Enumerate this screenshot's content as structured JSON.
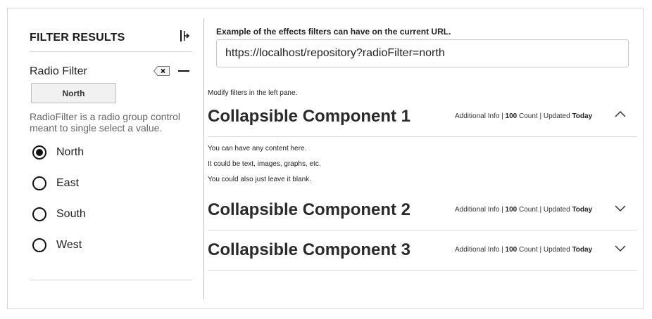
{
  "filter_pane": {
    "title": "FILTER RESULTS",
    "radio_filter": {
      "heading": "Radio Filter",
      "selected_chip": "North",
      "description": "RadioFilter is a radio group control meant to single select a value.",
      "options": [
        {
          "label": "North",
          "selected": true
        },
        {
          "label": "East",
          "selected": false
        },
        {
          "label": "South",
          "selected": false
        },
        {
          "label": "West",
          "selected": false
        }
      ]
    }
  },
  "main": {
    "url_caption": "Example of the effects filters can have on the current URL.",
    "url_value": "https://localhost/repository?radioFilter=north",
    "modify_note": "Modify filters in the left pane.",
    "components": [
      {
        "title": "Collapsible Component 1",
        "info": {
          "prefix": "Additional Info | ",
          "count": "100",
          "mid": " Count | Updated ",
          "updated": "Today"
        },
        "expanded": true,
        "content": [
          "You can have any content here.",
          "It could be text, images, graphs, etc.",
          "You could also just leave it blank."
        ]
      },
      {
        "title": "Collapsible Component 2",
        "info": {
          "prefix": "Additional Info | ",
          "count": "100",
          "mid": " Count | Updated ",
          "updated": "Today"
        },
        "expanded": false,
        "content": []
      },
      {
        "title": "Collapsible Component 3",
        "info": {
          "prefix": "Additional Info | ",
          "count": "100",
          "mid": " Count | Updated ",
          "updated": "Today"
        },
        "expanded": false,
        "content": []
      }
    ]
  }
}
